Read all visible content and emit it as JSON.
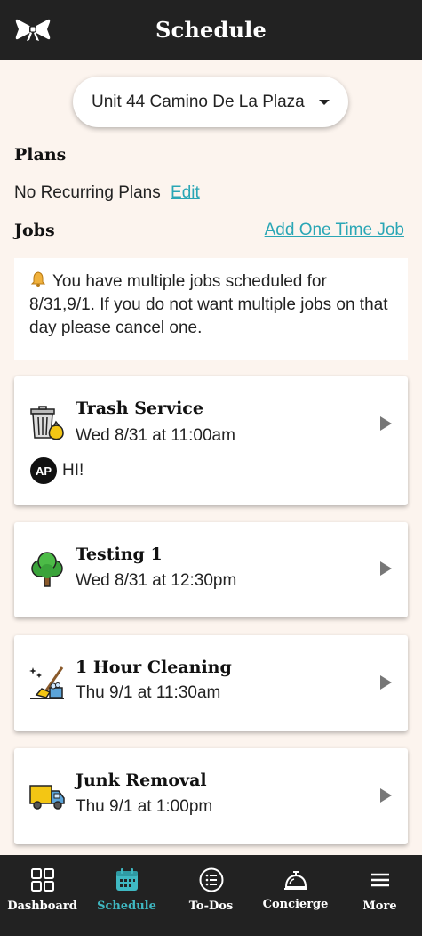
{
  "header": {
    "title": "Schedule"
  },
  "property_selector": {
    "value": "Unit 44 Camino De La Plaza"
  },
  "plans": {
    "heading": "Plans",
    "text": "No Recurring Plans",
    "edit_label": "Edit"
  },
  "jobs": {
    "heading": "Jobs",
    "add_label": "Add One Time Job",
    "alert_text": "You have multiple jobs scheduled for 8/31,9/1. If you do not want multiple jobs on that day please cancel one.",
    "items": [
      {
        "name": "Trash Service",
        "when": "Wed 8/31 at 11:00am",
        "icon": "trash-bin-icon",
        "note_initials": "AP",
        "note_text": "HI!"
      },
      {
        "name": "Testing 1",
        "when": "Wed 8/31 at 12:30pm",
        "icon": "tree-icon"
      },
      {
        "name": "1 Hour Cleaning",
        "when": "Thu 9/1 at 11:30am",
        "icon": "cleaning-icon"
      },
      {
        "name": "Junk Removal",
        "when": "Thu 9/1 at 1:00pm",
        "icon": "truck-icon"
      }
    ]
  },
  "nav": {
    "items": [
      {
        "label": "Dashboard",
        "icon": "grid-icon"
      },
      {
        "label": "Schedule",
        "icon": "calendar-icon",
        "active": true
      },
      {
        "label": "To-Dos",
        "icon": "list-icon"
      },
      {
        "label": "Concierge",
        "icon": "bell-service-icon"
      },
      {
        "label": "More",
        "icon": "menu-icon"
      }
    ]
  },
  "colors": {
    "bar": "#222222",
    "background": "#fcf4ee",
    "accent": "#2aa6b5",
    "active_tab": "#3fb8c2"
  }
}
